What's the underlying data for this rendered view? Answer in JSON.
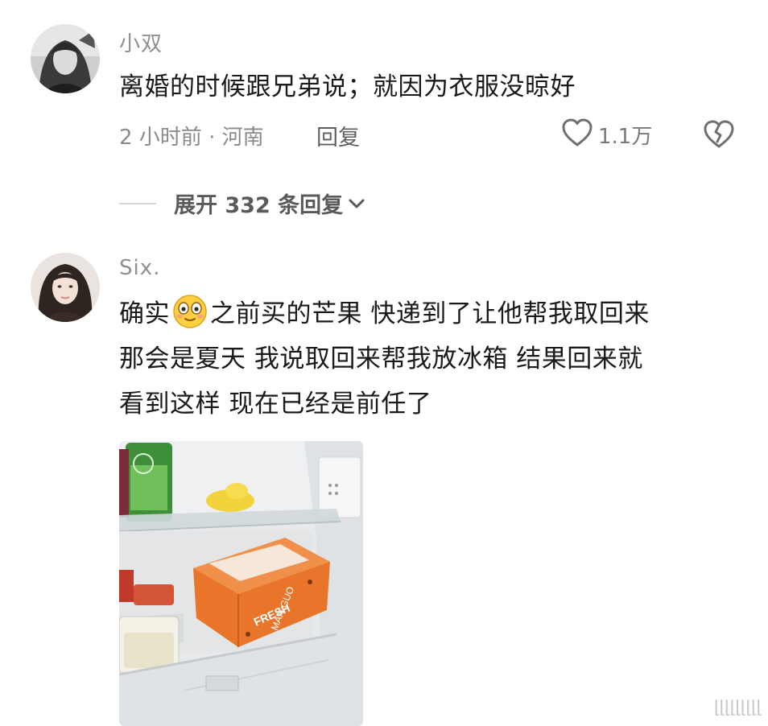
{
  "comments": [
    {
      "username": "小双",
      "text": "离婚的时候跟兄弟说；就因为衣服没晾好",
      "meta": "2 小时前 · 河南",
      "reply_label": "回复",
      "like_count": "1.1万",
      "expand_label": "展开 332 条回复"
    },
    {
      "username": "Six.",
      "text_before_emoji": "确实",
      "emoji": "smiling-emoji",
      "line1_after_emoji": "之前买的芒果 快递到了让他帮我取回来",
      "line2": "那会是夏天 我说取回来帮我放冰箱 结果回来就",
      "line3": "看到这样 现在已经是前任了"
    }
  ],
  "watermark": "⌊⌊⌊⌊⌊⌊⌊⌊⌊",
  "icons": {
    "like": "heart-outline-icon",
    "dislike": "broken-heart-icon",
    "expand": "chevron-down-icon"
  },
  "colors": {
    "username": "#8f8f8f",
    "text": "#1a1a1a",
    "meta": "#8a8a8a",
    "box_orange": "#e8752a"
  }
}
